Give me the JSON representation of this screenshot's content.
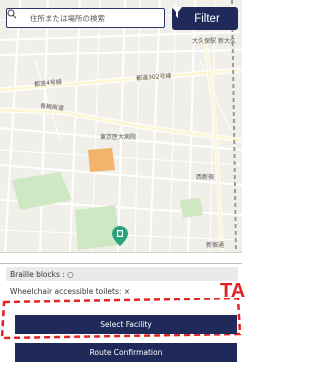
{
  "search": {
    "placeholder": "住所または場所の検索",
    "icon": "search-icon"
  },
  "filter": {
    "label": "Filter",
    "icon": "filter-funnel-icon"
  },
  "map": {
    "labels": {
      "okubo": "大久保駅",
      "shinokubo": "新大久",
      "road4": "都道4号線",
      "road302": "都道302号線",
      "ome_kaido": "青梅街道",
      "tokyo_medical": "東京医大病院",
      "nishi_shinjuku": "西新宿",
      "shinjuku_ave": "新宿通"
    },
    "colors": {
      "land": "#f1efe9",
      "road": "#ffffff",
      "major_road": "#fbf6d8",
      "park": "#cfe8c4",
      "hospital": "#f3b36a",
      "ui_navy": "#1f2a5a",
      "pin": "#2aa37a"
    }
  },
  "panel": {
    "braille": "Braille blocks : ○",
    "wheelchair": "Wheelchair accessible toilets: ×",
    "callout": "TA",
    "select_button": "Select Facility",
    "route_button": "Route Confirmation",
    "callout_color": "#e32222"
  }
}
